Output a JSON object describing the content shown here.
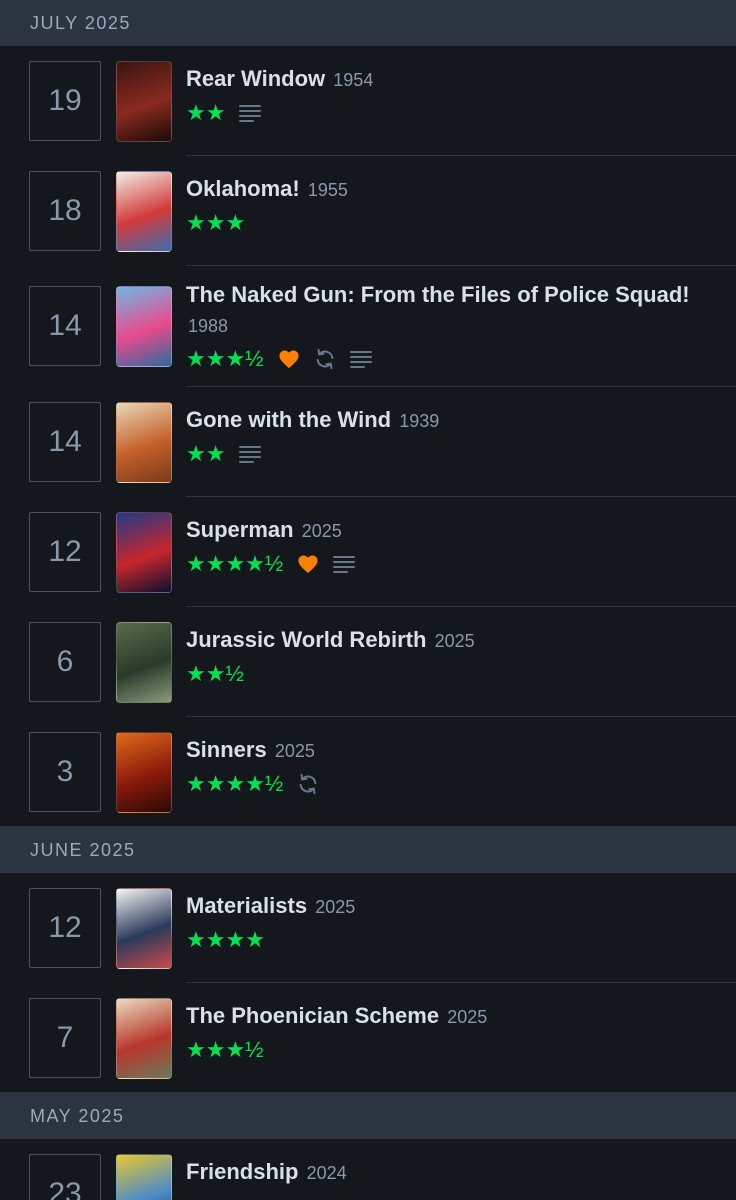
{
  "months": [
    {
      "label": "JULY 2025",
      "entries": [
        {
          "day": "19",
          "title": "Rear Window",
          "year": "1954",
          "stars": "★★",
          "liked": false,
          "rewatch": false,
          "review": true,
          "poster_colors": [
            "#3a1410",
            "#8a2a1e",
            "#1a0a08"
          ]
        },
        {
          "day": "18",
          "title": "Oklahoma!",
          "year": "1955",
          "stars": "★★★",
          "liked": false,
          "rewatch": false,
          "review": false,
          "poster_colors": [
            "#f2efe6",
            "#d23a3a",
            "#3a6db0"
          ]
        },
        {
          "day": "14",
          "title": "The Naked Gun: From the Files of Police Squad!",
          "year": "1988",
          "stars": "★★★½",
          "liked": true,
          "rewatch": true,
          "review": true,
          "poster_colors": [
            "#6fb8e6",
            "#e84a8c",
            "#2d6a9e"
          ]
        },
        {
          "day": "14",
          "title": "Gone with the Wind",
          "year": "1939",
          "stars": "★★",
          "liked": false,
          "rewatch": false,
          "review": true,
          "poster_colors": [
            "#e9d8b8",
            "#c4602a",
            "#7a3a1a"
          ]
        },
        {
          "day": "12",
          "title": "Superman",
          "year": "2025",
          "stars": "★★★★½",
          "liked": true,
          "rewatch": false,
          "review": true,
          "poster_colors": [
            "#1e3a8a",
            "#c8262a",
            "#0a1030"
          ]
        },
        {
          "day": "6",
          "title": "Jurassic World Rebirth",
          "year": "2025",
          "stars": "★★½",
          "liked": false,
          "rewatch": false,
          "review": false,
          "poster_colors": [
            "#5a6a4a",
            "#2a3a2a",
            "#8a9a7a"
          ]
        },
        {
          "day": "3",
          "title": "Sinners",
          "year": "2025",
          "stars": "★★★★½",
          "liked": false,
          "rewatch": true,
          "review": false,
          "poster_colors": [
            "#e06a1a",
            "#8a1a0a",
            "#2a0a05"
          ]
        }
      ]
    },
    {
      "label": "JUNE 2025",
      "entries": [
        {
          "day": "12",
          "title": "Materialists",
          "year": "2025",
          "stars": "★★★★",
          "liked": false,
          "rewatch": false,
          "review": false,
          "poster_colors": [
            "#f4f4f2",
            "#2a3a5a",
            "#c84a4a"
          ]
        },
        {
          "day": "7",
          "title": "The Phoenician Scheme",
          "year": "2025",
          "stars": "★★★½",
          "liked": false,
          "rewatch": false,
          "review": false,
          "poster_colors": [
            "#e8dcc0",
            "#b8362a",
            "#6a7a5a"
          ]
        }
      ]
    },
    {
      "label": "MAY 2025",
      "entries": [
        {
          "day": "23",
          "title": "Friendship",
          "year": "2024",
          "stars": "",
          "liked": false,
          "rewatch": false,
          "review": false,
          "poster_colors": [
            "#e8c830",
            "#4a8ac8",
            "#2a2a2a"
          ]
        }
      ]
    }
  ],
  "colors": {
    "background": "#14181c",
    "header_bg": "#2c3440",
    "star_green": "#00e054",
    "like_orange": "#ff8000",
    "icon_grey": "#678"
  }
}
